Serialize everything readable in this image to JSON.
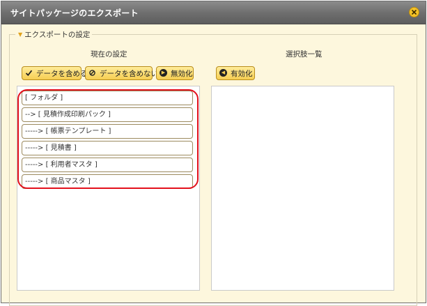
{
  "dialog": {
    "title": "サイトパッケージのエクスポート",
    "close_icon": "close-icon"
  },
  "section": {
    "legend": "エクスポートの設定"
  },
  "current": {
    "heading": "現在の設定",
    "buttons": [
      {
        "label": "データを含める",
        "icon": "check-icon"
      },
      {
        "label": "データを含めない",
        "icon": "no-entry-icon"
      },
      {
        "label": "無効化",
        "icon": "arrow-right-circle-icon"
      }
    ],
    "items": [
      "[ フォルダ ]",
      "--> [ 見積作成印刷パック ]",
      "-----> [ 帳票テンプレート ]",
      "-----> [ 見積書 ]",
      "-----> [ 利用者マスタ ]",
      "-----> [ 商品マスタ ]"
    ]
  },
  "choices": {
    "heading": "選択肢一覧",
    "enable_button": {
      "label": "有効化",
      "icon": "arrow-left-circle-icon"
    }
  },
  "colors": {
    "titlebar": "#6f6f6f",
    "background": "#fdf7dd",
    "button": "#f6ce52",
    "highlight": "#e3101c"
  }
}
